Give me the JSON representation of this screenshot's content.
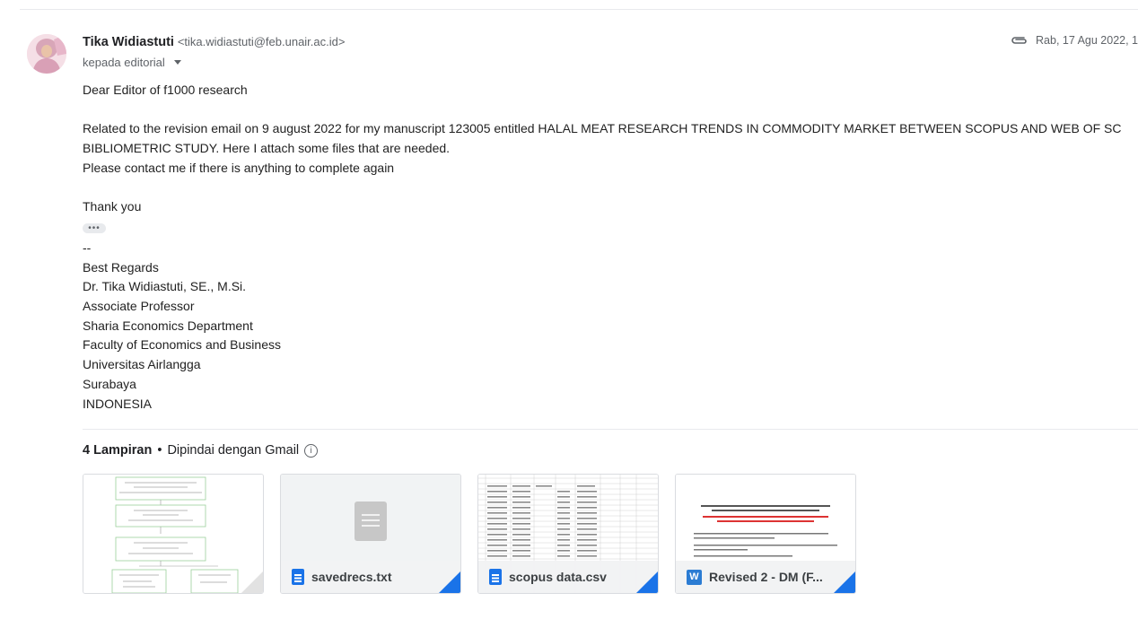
{
  "sender": {
    "name": "Tika Widiastuti",
    "email": "<tika.widiastuti@feb.unair.ac.id>",
    "to_label": "kepada editorial",
    "date": "Rab, 17 Agu 2022, 1",
    "attachment_icon": "paperclip-icon"
  },
  "body": {
    "greeting": "Dear Editor of f1000 research",
    "line1": "Related to the revision email on 9 august 2022 for my manuscript 123005 entitled  HALAL MEAT RESEARCH TRENDS IN COMMODITY MARKET BETWEEN SCOPUS AND WEB OF SC",
    "line2": "BIBLIOMETRIC STUDY. Here I attach some files that are needed.",
    "line3": "Please contact me if there is anything to complete again",
    "thanks": "Thank you",
    "dots": "•••",
    "sig_dash": "--",
    "signature": [
      "Best Regards",
      "Dr. Tika Widiastuti, SE., M.Si.",
      "Associate Professor",
      "Sharia Economics Department",
      "Faculty of Economics and Business",
      "Universitas Airlangga",
      "Surabaya",
      "INDONESIA"
    ]
  },
  "attachments": {
    "count_label": "4 Lampiran",
    "bullet": "•",
    "scanned_label": "Dipindai dengan Gmail",
    "info_glyph": "i",
    "files": [
      {
        "name": "",
        "icon": "image-thumbnail"
      },
      {
        "name": "savedrecs.txt",
        "icon": "google-doc-icon"
      },
      {
        "name": "scopus data.csv",
        "icon": "google-doc-icon"
      },
      {
        "name": "Revised 2 - DM (F...",
        "icon": "word-icon",
        "icon_letter": "W"
      }
    ]
  },
  "colors": {
    "accent": "#1a73e8",
    "word": "#2b7cd3",
    "muted": "#5f6368"
  }
}
